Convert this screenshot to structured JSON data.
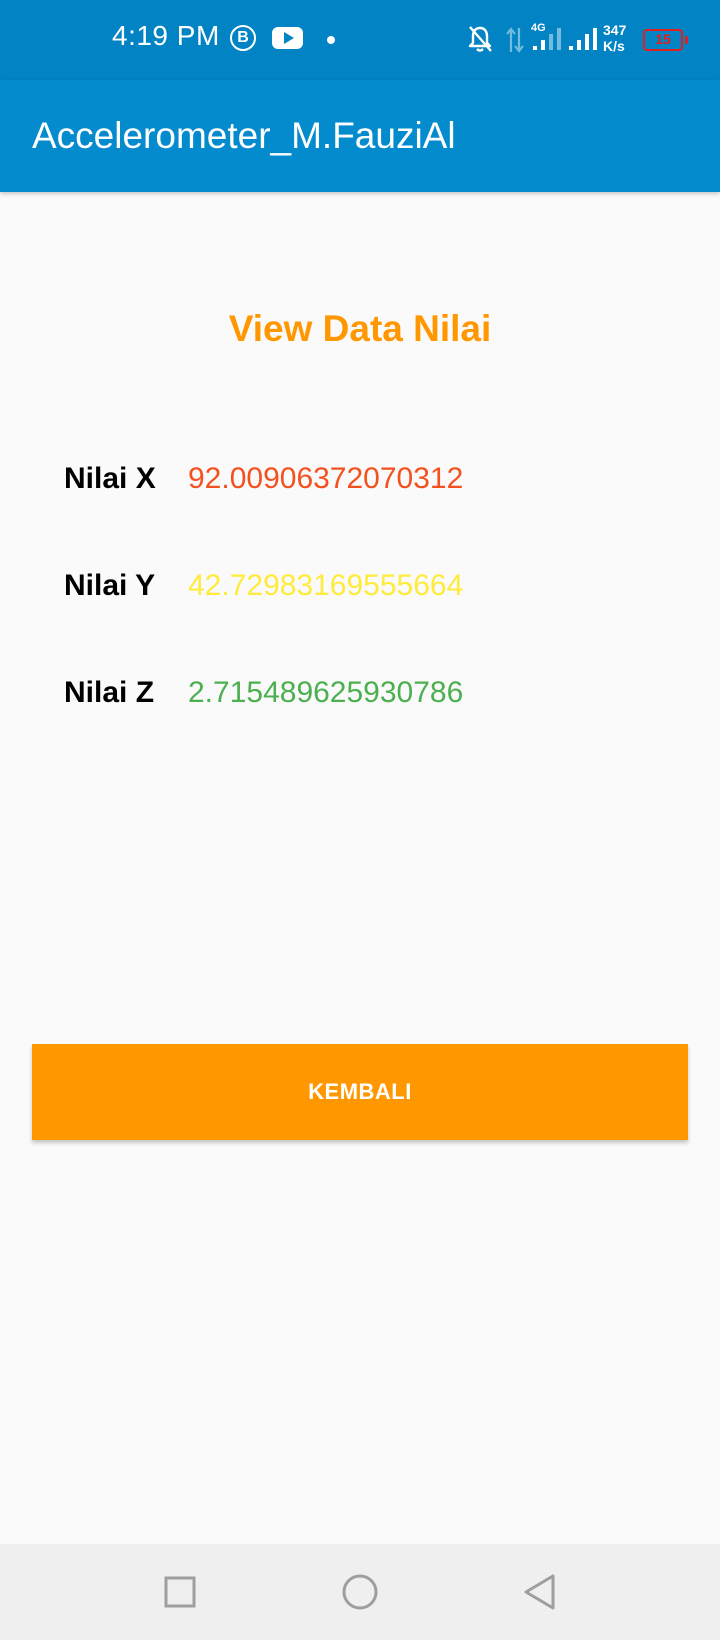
{
  "status_bar": {
    "time": "4:19 PM",
    "b_badge": "B",
    "network_label": "4G",
    "speed_value": "347",
    "speed_unit": "K/s",
    "battery_level": "15",
    "icons": [
      "b-badge-icon",
      "youtube-icon",
      "dot-icon",
      "bell-off-icon",
      "data-arrows-icon",
      "signal-icon",
      "signal-icon",
      "battery-icon"
    ]
  },
  "app_bar": {
    "title": "Accelerometer_M.FauziAl"
  },
  "main": {
    "heading": "View Data Nilai",
    "rows": [
      {
        "label": "Nilai X",
        "value": "92.00906372070312",
        "color": "#f4511e"
      },
      {
        "label": "Nilai Y",
        "value": "42.72983169555664",
        "color": "#ffeb3b"
      },
      {
        "label": "Nilai Z",
        "value": "2.715489625930786",
        "color": "#4caf50"
      }
    ],
    "back_button_label": "KEMBALI"
  },
  "nav_bar": {
    "buttons": [
      "recents-icon",
      "home-icon",
      "back-icon"
    ]
  },
  "colors": {
    "status_bar": "#0284c4",
    "app_bar": "#038bce",
    "accent": "#ff9800",
    "background": "#fafafa",
    "nav_bar": "#efefef"
  }
}
